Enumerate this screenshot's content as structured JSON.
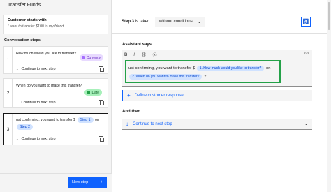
{
  "left_panel": {
    "title": "Transfer Funds",
    "starts_with_label": "Customer starts with:",
    "starts_with_text": "I want to transfer $100 to my friend",
    "steps_heading": "Conversation steps",
    "steps": [
      {
        "number": "1",
        "question": "How much would you like to transfer?",
        "tag": "Currency",
        "continue": "Continue to next step"
      },
      {
        "number": "2",
        "question": "When do you want to make this transfer?",
        "tag": "Date",
        "continue": "Continue to next step"
      },
      {
        "number": "3",
        "text_prefix": "ust confirming, you want to transfer $",
        "var1": "Step 1",
        "text_mid": "on",
        "var2": "Step 2",
        "text_suffix": "?",
        "continue": "Continue to next step"
      }
    ],
    "new_step_label": "New step",
    "new_step_icon": "+"
  },
  "right_panel": {
    "step_label": "Step 3",
    "is_taken": "is taken",
    "condition_value": "without conditions",
    "assistant_says_label": "Assistant says",
    "toolbar": {
      "bold": "B",
      "italic": "I",
      "link": "⛓",
      "code": "</>"
    },
    "editor": {
      "text_prefix": "ust confirming, you want to transfer $",
      "var1": "1. How much would you like to transfer?",
      "text_mid": "on",
      "var2": "2. When do you want to make this transfer?",
      "text_suffix": "?"
    },
    "define_response": "Define customer response",
    "and_then_label": "And then",
    "continue_value": "Continue to next step"
  },
  "colors": {
    "primary": "#0f62fe",
    "highlight_border": "#24a148",
    "currency_tag_bg": "#e8daff",
    "date_tag_bg": "#a7f0ba"
  }
}
